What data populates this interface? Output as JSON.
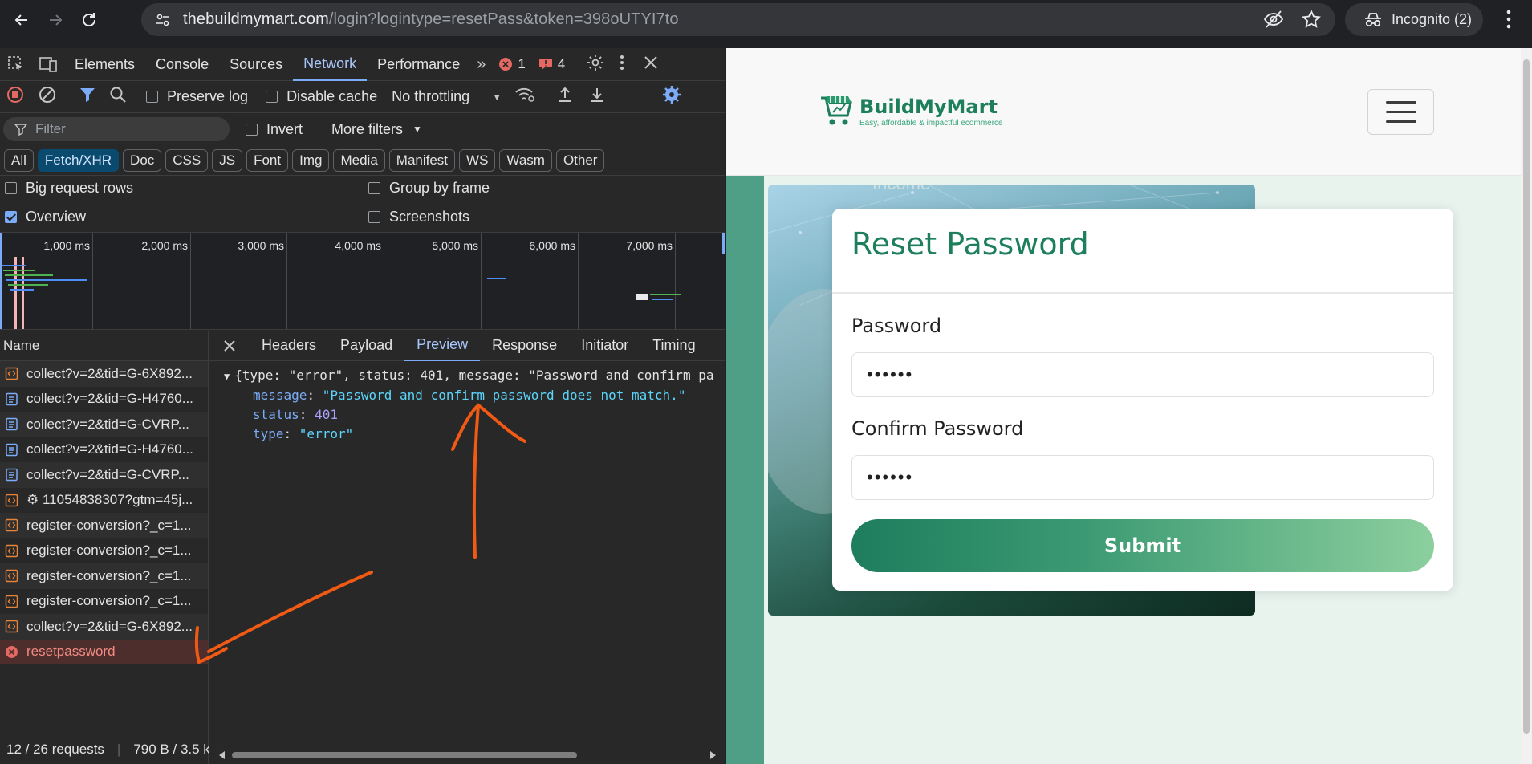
{
  "browser": {
    "url_host": "thebuildmymart.com",
    "url_path": "/login?logintype=resetPass&token=398oUTYI7to",
    "profile_label": "Incognito (2)"
  },
  "devtools": {
    "tabs": [
      "Elements",
      "Console",
      "Sources",
      "Network",
      "Performance"
    ],
    "active_tab": "Network",
    "error_count": "1",
    "issue_count": "4",
    "toolbar": {
      "preserve_log": "Preserve log",
      "disable_cache": "Disable cache",
      "throttling": "No throttling"
    },
    "filter": {
      "placeholder": "Filter",
      "invert": "Invert",
      "more_filters": "More filters"
    },
    "types": [
      "All",
      "Fetch/XHR",
      "Doc",
      "CSS",
      "JS",
      "Font",
      "Img",
      "Media",
      "Manifest",
      "WS",
      "Wasm",
      "Other"
    ],
    "active_type": "Fetch/XHR",
    "options": {
      "big_request_rows": "Big request rows",
      "group_by_frame": "Group by frame",
      "overview": "Overview",
      "screenshots": "Screenshots"
    },
    "timeline_ticks": [
      "1,000 ms",
      "2,000 ms",
      "3,000 ms",
      "4,000 ms",
      "5,000 ms",
      "6,000 ms",
      "7,000 ms"
    ],
    "requests_header": "Name",
    "requests": [
      {
        "name": "collect?v=2&tid=G-6X892...",
        "kind": "xhr"
      },
      {
        "name": "collect?v=2&tid=G-H4760...",
        "kind": "doc"
      },
      {
        "name": "collect?v=2&tid=G-CVRP...",
        "kind": "doc"
      },
      {
        "name": "collect?v=2&tid=G-H4760...",
        "kind": "doc"
      },
      {
        "name": "collect?v=2&tid=G-CVRP...",
        "kind": "doc"
      },
      {
        "name": "⚙ 11054838307?gtm=45j...",
        "kind": "xhr"
      },
      {
        "name": "register-conversion?_c=1...",
        "kind": "xhr"
      },
      {
        "name": "register-conversion?_c=1...",
        "kind": "xhr"
      },
      {
        "name": "register-conversion?_c=1...",
        "kind": "xhr"
      },
      {
        "name": "register-conversion?_c=1...",
        "kind": "xhr"
      },
      {
        "name": "collect?v=2&tid=G-6X892...",
        "kind": "xhr"
      },
      {
        "name": "resetpassword",
        "kind": "error"
      }
    ],
    "footer": {
      "requests": "12 / 26 requests",
      "transferred": "790 B / 3.5 k"
    },
    "detail_tabs": [
      "Headers",
      "Payload",
      "Preview",
      "Response",
      "Initiator",
      "Timing"
    ],
    "active_detail_tab": "Preview",
    "preview": {
      "summary": "{type: \"error\", status: 401, message: \"Password and confirm pa",
      "message_key": "message",
      "message_value": "\"Password and confirm password does not match.\"",
      "status_key": "status",
      "status_value": "401",
      "type_key": "type",
      "type_value": "\"error\""
    }
  },
  "page": {
    "brand_name": "BuildMyMart",
    "brand_tagline": "Easy, affordable & impactful ecommerce",
    "hero_ghost_text": "Income",
    "card_title": "Reset Password",
    "password_label": "Password",
    "password_value": "••••••",
    "confirm_label": "Confirm Password",
    "confirm_value": "••••••",
    "submit_label": "Submit"
  },
  "colors": {
    "brand_green": "#1d7f5c",
    "annotation_orange": "#f05a14",
    "devtools_accent": "#7cacf8",
    "error_red": "#f28b82"
  }
}
